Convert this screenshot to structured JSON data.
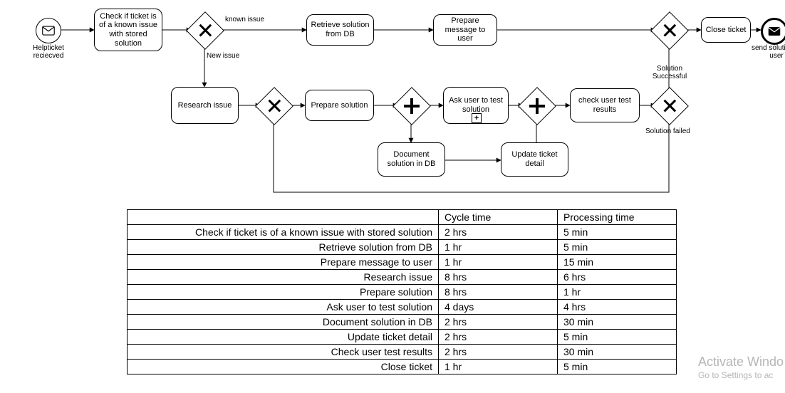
{
  "diagram": {
    "start_event": {
      "label": "Helpticket reciecved",
      "icon": "envelope"
    },
    "end_event": {
      "label": "send solution to user",
      "icon": "envelope-filled"
    },
    "tasks": {
      "check_known": "Check if ticket is of a known issue with stored solution",
      "retrieve": "Retrieve solution from DB",
      "prepare_msg": "Prepare message to user",
      "close": "Close ticket",
      "research": "Research issue",
      "prepare_sol": "Prepare solution",
      "ask_user": "Ask user to test solution",
      "document": "Document solution in DB",
      "update": "Update ticket detail",
      "check_results": "check user test results"
    },
    "edge_labels": {
      "known": "known issue",
      "new": "New issue",
      "success": "Solution Successful",
      "failed": "Solution failed"
    }
  },
  "table": {
    "headers": {
      "cycle": "Cycle time",
      "processing": "Processing time"
    },
    "rows": [
      {
        "name": "Check if ticket is of a known issue with stored solution",
        "cycle": "2 hrs",
        "processing": "5 min"
      },
      {
        "name": "Retrieve solution from DB",
        "cycle": "1 hr",
        "processing": "5 min"
      },
      {
        "name": "Prepare message to user",
        "cycle": "1 hr",
        "processing": "15 min"
      },
      {
        "name": "Research issue",
        "cycle": "8 hrs",
        "processing": "6 hrs"
      },
      {
        "name": "Prepare solution",
        "cycle": "8 hrs",
        "processing": "1 hr"
      },
      {
        "name": "Ask user to test solution",
        "cycle": "4 days",
        "processing": "4 hrs"
      },
      {
        "name": "Document solution in DB",
        "cycle": "2 hrs",
        "processing": "30 min"
      },
      {
        "name": "Update ticket detail",
        "cycle": "2 hrs",
        "processing": "5 min"
      },
      {
        "name": "Check user test results",
        "cycle": "2 hrs",
        "processing": "30 min"
      },
      {
        "name": "Close ticket",
        "cycle": "1 hr",
        "processing": "5 min"
      }
    ]
  },
  "watermark": {
    "line1": "Activate Windo",
    "line2": "Go to Settings to ac"
  }
}
